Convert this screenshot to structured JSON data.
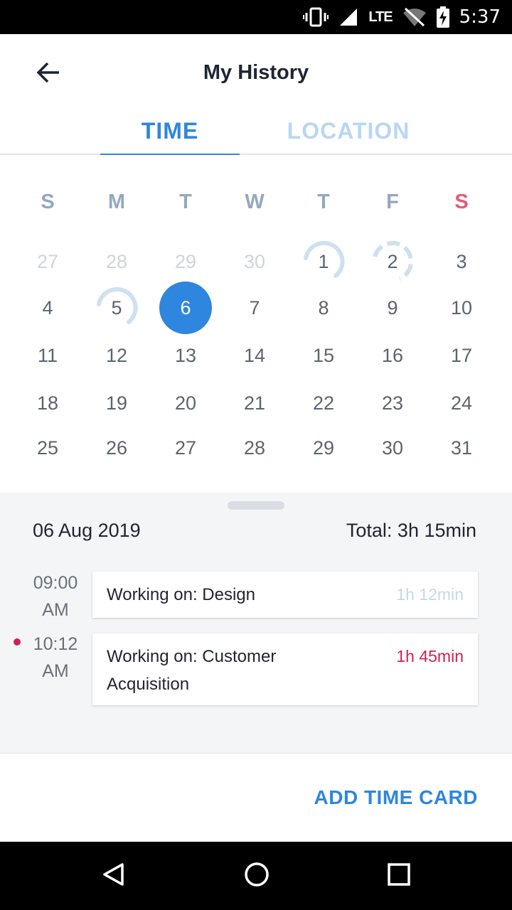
{
  "status_bar": {
    "time": "5:37",
    "network": "LTE",
    "icons": [
      "vibrate-icon",
      "signal-icon",
      "wifi-off-icon",
      "battery-charging-icon"
    ]
  },
  "header": {
    "title": "My History",
    "back_icon": "arrow-left-icon"
  },
  "tabs": [
    {
      "label": "TIME",
      "active": true
    },
    {
      "label": "LOCATION",
      "active": false
    }
  ],
  "calendar": {
    "weekdays": [
      "S",
      "M",
      "T",
      "W",
      "T",
      "F",
      "S"
    ],
    "weeks": [
      [
        "27",
        "28",
        "29",
        "30",
        "1",
        "2",
        "3"
      ],
      [
        "4",
        "5",
        "6",
        "7",
        "8",
        "9",
        "10"
      ],
      [
        "11",
        "12",
        "13",
        "14",
        "15",
        "16",
        "17"
      ],
      [
        "18",
        "19",
        "20",
        "21",
        "22",
        "23",
        "24"
      ],
      [
        "25",
        "26",
        "27",
        "28",
        "29",
        "30",
        "31"
      ]
    ],
    "muted_days_first_week": 4,
    "selected_day": "6",
    "activity_days": [
      {
        "day": "1",
        "style": "partial"
      },
      {
        "day": "2",
        "style": "dashed"
      },
      {
        "day": "5",
        "style": "partial"
      }
    ]
  },
  "day_detail": {
    "date": "06 Aug 2019",
    "total": "Total: 3h 15min",
    "entries": [
      {
        "time": "09:00",
        "meridiem": "AM",
        "label": "Working on: Design",
        "label_line2": "",
        "duration": "1h 12min",
        "active": false
      },
      {
        "time": "10:12",
        "meridiem": "AM",
        "label": "Working on: Customer",
        "label_line2": "Acquisition",
        "duration": "1h 45min",
        "active": true
      }
    ]
  },
  "footer": {
    "add_label": "ADD TIME CARD"
  },
  "colors": {
    "accent": "#2f86de",
    "accent_light": "#b9d6f4",
    "active_red": "#d3204f",
    "sunday_saturday_red": "#e8587a",
    "inactive_duration": "#c3d9ee"
  }
}
